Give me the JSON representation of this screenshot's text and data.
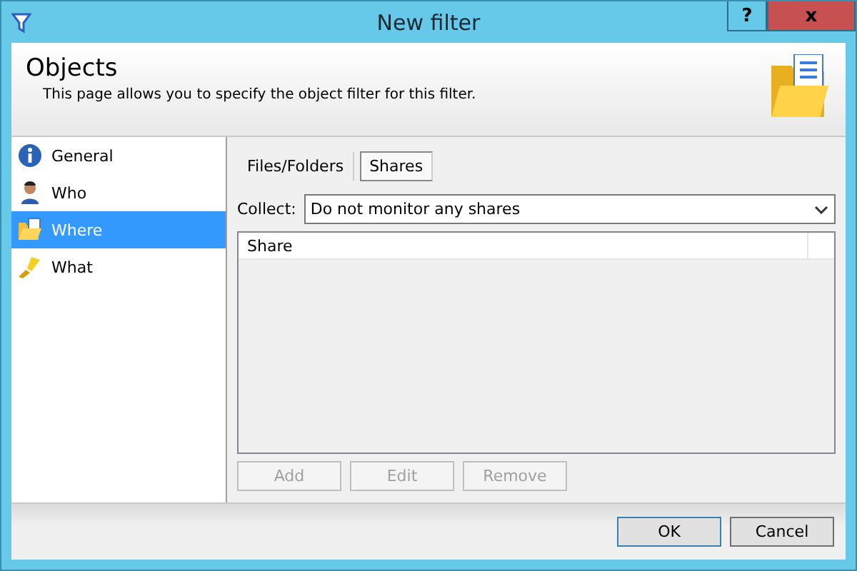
{
  "window": {
    "title": "New filter",
    "help": "?",
    "close": "x"
  },
  "header": {
    "title": "Objects",
    "description": "This page allows you to specify the object filter for this filter."
  },
  "sidebar": {
    "items": [
      {
        "label": "General",
        "kind": "info",
        "selected": false
      },
      {
        "label": "Who",
        "kind": "user",
        "selected": false
      },
      {
        "label": "Where",
        "kind": "folder",
        "selected": true
      },
      {
        "label": "What",
        "kind": "brush",
        "selected": false
      }
    ]
  },
  "tabs": [
    {
      "label": "Files/Folders",
      "selected": false
    },
    {
      "label": "Shares",
      "selected": true
    }
  ],
  "collect": {
    "label": "Collect:",
    "value": "Do not monitor any shares"
  },
  "table": {
    "columns": [
      "Share"
    ]
  },
  "list_buttons": [
    {
      "label": "Add",
      "disabled": true
    },
    {
      "label": "Edit",
      "disabled": true
    },
    {
      "label": "Remove",
      "disabled": true
    }
  ],
  "buttons": [
    {
      "label": "OK",
      "default": true
    },
    {
      "label": "Cancel",
      "default": false
    }
  ]
}
